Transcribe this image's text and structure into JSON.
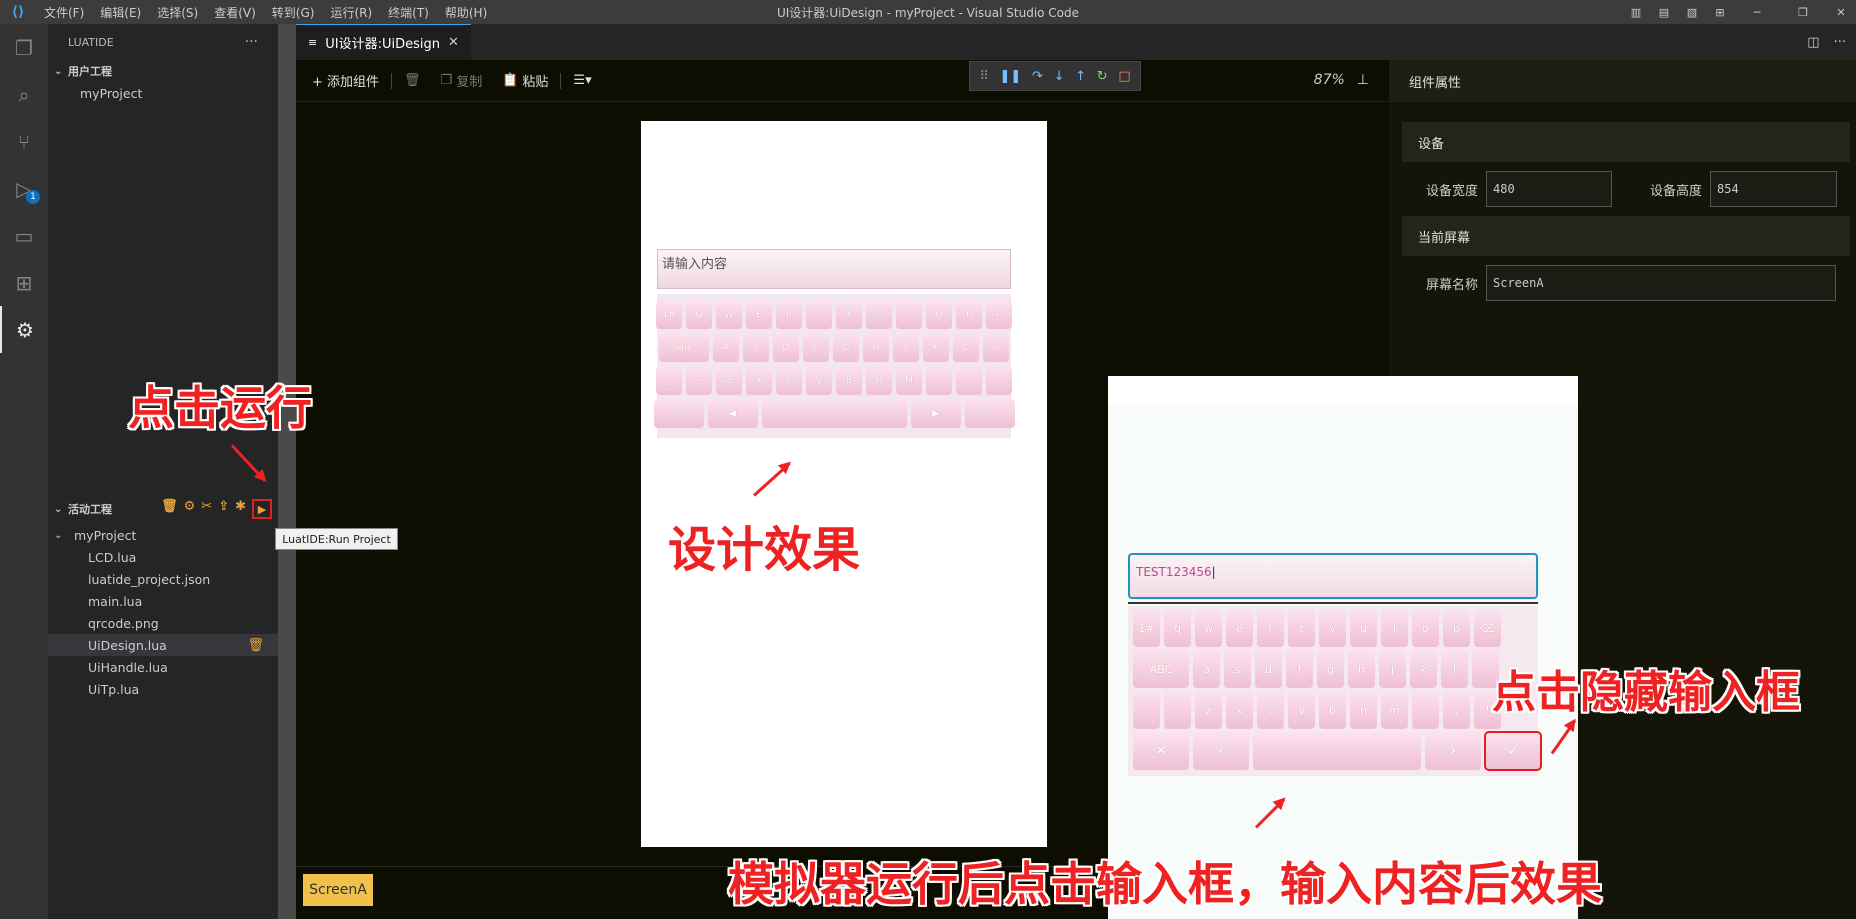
{
  "window": {
    "title": "UI设计器:UiDesign - myProject - Visual Studio Code",
    "menu": [
      "文件(F)",
      "编辑(E)",
      "选择(S)",
      "查看(V)",
      "转到(G)",
      "运行(R)",
      "终端(T)",
      "帮助(H)"
    ],
    "debug_badge": "1"
  },
  "sidebar": {
    "header": "LUATIDE",
    "more": "···",
    "user_section": "用户工程",
    "user_project": "myProject",
    "active_section": "活动工程",
    "active_project": "myProject",
    "files": [
      "LCD.lua",
      "luatide_project.json",
      "main.lua",
      "qrcode.png",
      "UiDesign.lua",
      "UiHandle.lua",
      "UiTp.lua"
    ]
  },
  "tooltip": "LuatIDE:Run Project",
  "tab": {
    "label": "UI设计器:UiDesign"
  },
  "toolbar": {
    "add": "+ 添加组件",
    "copy": "复制",
    "paste": "粘贴",
    "zoom": "87%"
  },
  "design": {
    "placeholder": "请输入内容",
    "kb_row1": [
      "1#",
      "Q",
      "W",
      "E",
      "R",
      "T",
      "Y",
      "U",
      "I",
      "O",
      "P",
      "←"
    ],
    "kb_row2": [
      "abc",
      "A",
      "S",
      "D",
      "F",
      "G",
      "H",
      "J",
      "K",
      "L",
      "↵"
    ],
    "kb_row3": [
      "_",
      "—",
      "Z",
      "X",
      "C",
      "V",
      "B",
      "N",
      "M",
      ".",
      ",",
      "."
    ],
    "kb_row4": [
      "⊟",
      "◀",
      "",
      "▶",
      "✓"
    ]
  },
  "screen_tag": "ScreenA",
  "emulator": {
    "input_value": "TEST123456",
    "kb_row1": [
      "1#",
      "q",
      "w",
      "e",
      "r",
      "t",
      "y",
      "u",
      "i",
      "o",
      "p",
      "⌫"
    ],
    "kb_row2": [
      "ABC",
      "a",
      "s",
      "d",
      "f",
      "g",
      "h",
      "j",
      "k",
      "l",
      ""
    ],
    "kb_row3": [
      ".",
      ".",
      "z",
      "x",
      "c",
      "v",
      "b",
      "n",
      "m",
      ".",
      ",",
      "!"
    ],
    "kb_row4": [
      "✕",
      "‹",
      "",
      "›",
      "✓"
    ]
  },
  "props": {
    "header": "组件属性",
    "device_section": "设备",
    "width_label": "设备宽度",
    "width_value": "480",
    "height_label": "设备高度",
    "height_value": "854",
    "screen_section": "当前屏幕",
    "screen_name_label": "屏幕名称",
    "screen_name_value": "ScreenA"
  },
  "annotations": {
    "run": "点击运行",
    "design_effect": "设计效果",
    "hide_input": "点击隐藏输入框",
    "emulator_effect": "模拟器运行后点击输入框，输入内容后效果"
  },
  "colors": {
    "annotation_red": "#ee2222",
    "accent_blue": "#3fa7f0",
    "tab_yellow": "#f0c24b",
    "icon_orange": "#e8a23a"
  }
}
